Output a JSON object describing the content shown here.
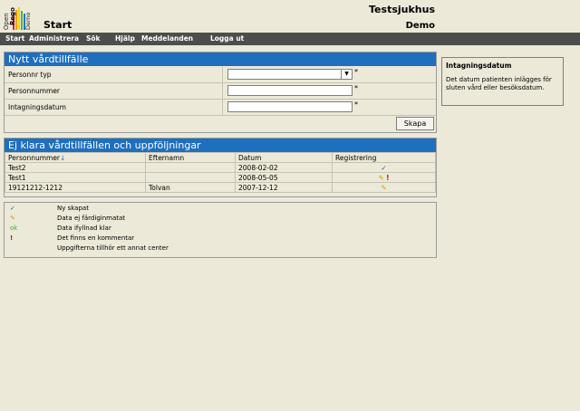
{
  "header": {
    "logo_text": "Open Rego Demo",
    "page_title": "Start",
    "hospital": "Testsjukhus",
    "environment": "Demo"
  },
  "nav": {
    "items": [
      "Start",
      "Administrera",
      "Sök",
      "Hjälp",
      "Meddelanden",
      "Logga ut"
    ]
  },
  "new_case": {
    "title": "Nytt vårdtillfälle",
    "fields": [
      {
        "label": "Personnr typ",
        "value": "",
        "required_mark": "*"
      },
      {
        "label": "Personnummer",
        "value": "",
        "required_mark": "*"
      },
      {
        "label": "Intagningsdatum",
        "value": "",
        "required_mark": "*"
      }
    ],
    "create_button": "Skapa"
  },
  "pending": {
    "title": "Ej klara vårdtillfällen och uppföljningar",
    "columns": [
      "Personnummer",
      "Efternamn",
      "Datum",
      "Registrering"
    ],
    "rows": [
      {
        "personnummer": "Test2",
        "efternamn": "",
        "datum": "2008-02-02",
        "status": [
          "new"
        ]
      },
      {
        "personnummer": "Test1",
        "efternamn": "",
        "datum": "2008-05-05",
        "status": [
          "incomplete",
          "comment"
        ]
      },
      {
        "personnummer": "19121212-1212",
        "efternamn": "Tolvan",
        "datum": "2007-12-12",
        "status": [
          "incomplete"
        ]
      }
    ]
  },
  "legend": [
    {
      "icon": "check-icon",
      "text": "Ny skapat"
    },
    {
      "icon": "pencil-icon",
      "text": "Data ej färdiginmatat"
    },
    {
      "icon": "ok-icon",
      "text": "Data ifyllnad klar"
    },
    {
      "icon": "exclamation-icon",
      "text": "Det finns en kommentar"
    },
    {
      "icon": "none",
      "text": "Uppgifterna tillhör ett annat center"
    }
  ],
  "help": {
    "title": "Intagningsdatum",
    "text": "Det datum patienten inlägges för sluten vård eller besöksdatum."
  },
  "colors": {
    "panel_header": "#1f6fbf",
    "nav_bar": "#4d4d4d",
    "background": "#ece9d8"
  }
}
